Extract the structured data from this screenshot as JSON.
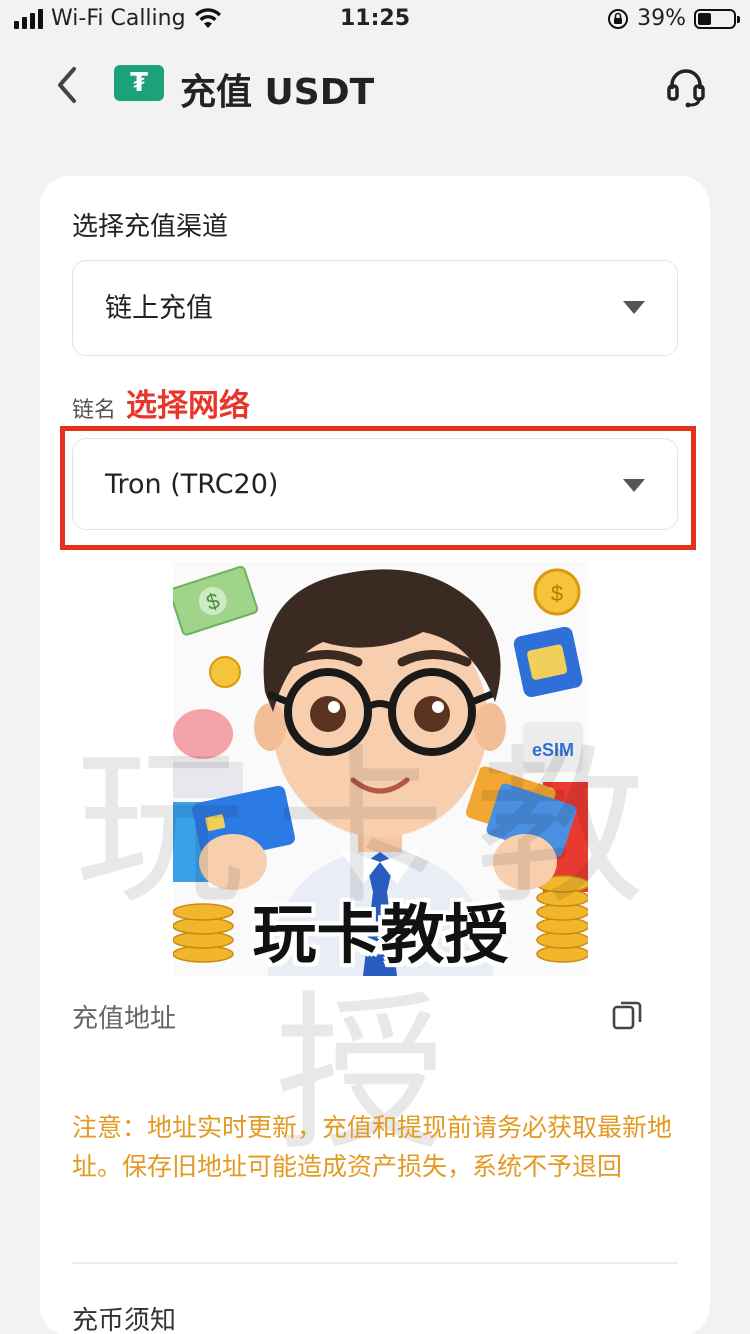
{
  "status_bar": {
    "carrier": "Wi-Fi Calling",
    "time": "11:25",
    "battery": "39%",
    "battery_level": 0.39
  },
  "header": {
    "logo_text": "₮",
    "title": "充值 USDT"
  },
  "form": {
    "channel_label": "选择充值渠道",
    "channel_value": "链上充值",
    "chain_label": "链名",
    "chain_hint": "选择网络",
    "network_value": "Tron (TRC20)"
  },
  "illustration": {
    "caption": "玩卡教授",
    "badge": "eSIM"
  },
  "watermark": "玩卡教授",
  "address": {
    "label": "充值地址"
  },
  "notice": "注意：地址实时更新，充值和提现前请务必获取最新地址。保存旧地址可能造成资产损失，系统不予退回",
  "bottom": {
    "text": "充币须知"
  },
  "colors": {
    "usdt_green": "#1ba27a",
    "hint_red": "#e8362b",
    "notice_orange": "#e39a22",
    "highlight_border": "#e2321f"
  }
}
